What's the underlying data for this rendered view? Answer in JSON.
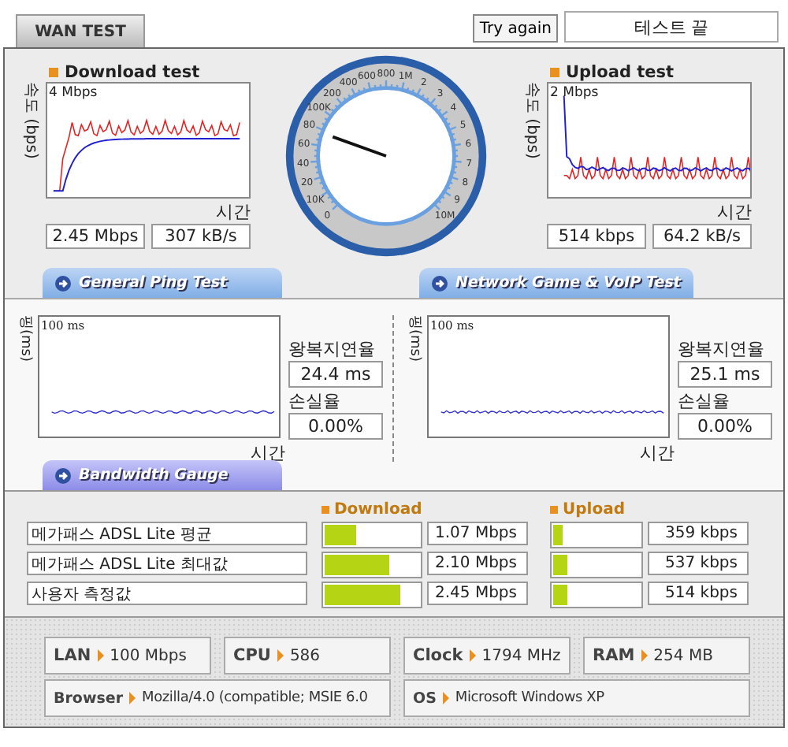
{
  "tab": "WAN TEST",
  "retry_button": "Try again",
  "status": "테스트 끝",
  "download": {
    "title": "Download test",
    "y_axis": "속도 (bps)",
    "scale": "4 Mbps",
    "x_axis": "시간",
    "rate": "2.45 Mbps",
    "bytes": "307 kB/s"
  },
  "gauge": {
    "top_arc": [
      "100K",
      "200",
      "400",
      "600",
      "800",
      "1M"
    ],
    "left_arc": [
      "80",
      "60",
      "40",
      "20",
      "10K",
      "0"
    ],
    "right_arc": [
      "2",
      "3",
      "4",
      "5",
      "6",
      "7",
      "8",
      "9",
      "10M"
    ]
  },
  "upload": {
    "title": "Upload test",
    "y_axis": "속도 (bps)",
    "scale": "2 Mbps",
    "x_axis": "시간",
    "rate": "514 kbps",
    "bytes": "64.2 kB/s"
  },
  "ping_tests": [
    {
      "title": "General Ping Test",
      "y_axis": "핑(ms)",
      "scale": "100 ms",
      "x_axis": "시간",
      "latency_label": "왕복지연율",
      "latency": "24.4 ms",
      "loss_label": "손실율",
      "loss": "0.00%"
    },
    {
      "title": "Network Game & VoIP Test",
      "y_axis": "핑(ms)",
      "scale": "100 ms",
      "x_axis": "시간",
      "latency_label": "왕복지연율",
      "latency": "25.1 ms",
      "loss_label": "손실율",
      "loss": "0.00%"
    }
  ],
  "bandwidth": {
    "title": "Bandwidth Gauge",
    "download_header": "Download",
    "upload_header": "Upload",
    "rows": [
      {
        "label": "메가패스 ADSL Lite 평균",
        "download": {
          "level": 0.34,
          "reading": "1.07 Mbps"
        },
        "upload": {
          "level": 0.1,
          "reading": "359 kbps"
        }
      },
      {
        "label": "메가패스 ADSL Lite 최대값",
        "download": {
          "level": 0.68,
          "reading": "2.10 Mbps"
        },
        "upload": {
          "level": 0.17,
          "reading": "537 kbps"
        }
      },
      {
        "label": "사용자 측정값",
        "download": {
          "level": 0.8,
          "reading": "2.45 Mbps"
        },
        "upload": {
          "level": 0.17,
          "reading": "514 kbps"
        }
      }
    ]
  },
  "system_info": [
    {
      "label": "LAN",
      "value": "100 Mbps"
    },
    {
      "label": "CPU",
      "value": "586"
    },
    {
      "label": "Clock",
      "value": "1794 MHz"
    },
    {
      "label": "RAM",
      "value": "254 MB"
    },
    {
      "label": "Browser",
      "value": "Mozilla/4.0 (compatible; MSIE 6.0"
    },
    {
      "label": "OS",
      "value": "Microsoft Windows XP"
    }
  ]
}
